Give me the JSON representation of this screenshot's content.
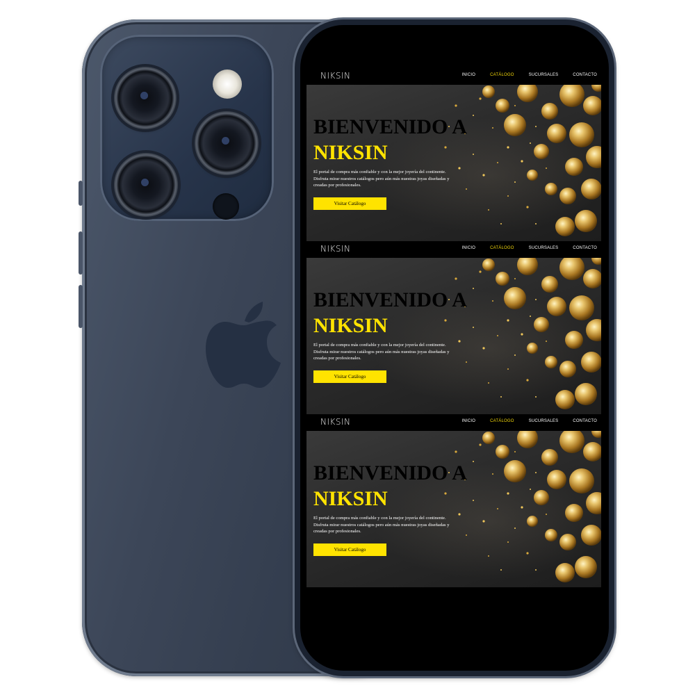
{
  "site": {
    "logo": "NIKSIN",
    "nav": {
      "items": [
        "INICIO",
        "CATÁLOGO",
        "SUCURSALES",
        "CONTACTO"
      ],
      "active_index": 1
    },
    "hero": {
      "title_line1": "BIENVENIDO A",
      "title_line2": "NIKSIN",
      "text": "El portal de compra más confiable y con la mejor joyería del continente. Disfruta mirar nuestros catálogos pero aún más nuestras joyas diseñadas y creadas por profesionales.",
      "button": "Visitar Catálogo"
    }
  },
  "colors": {
    "accent": "#ffe300",
    "nav_bg": "#000000",
    "hero_bg": "#2d2d2d",
    "text": "#ffffff",
    "phone_body": "#3c4658"
  },
  "icons": [
    "apple-logo-icon",
    "camera-lens-icon",
    "flash-icon"
  ]
}
